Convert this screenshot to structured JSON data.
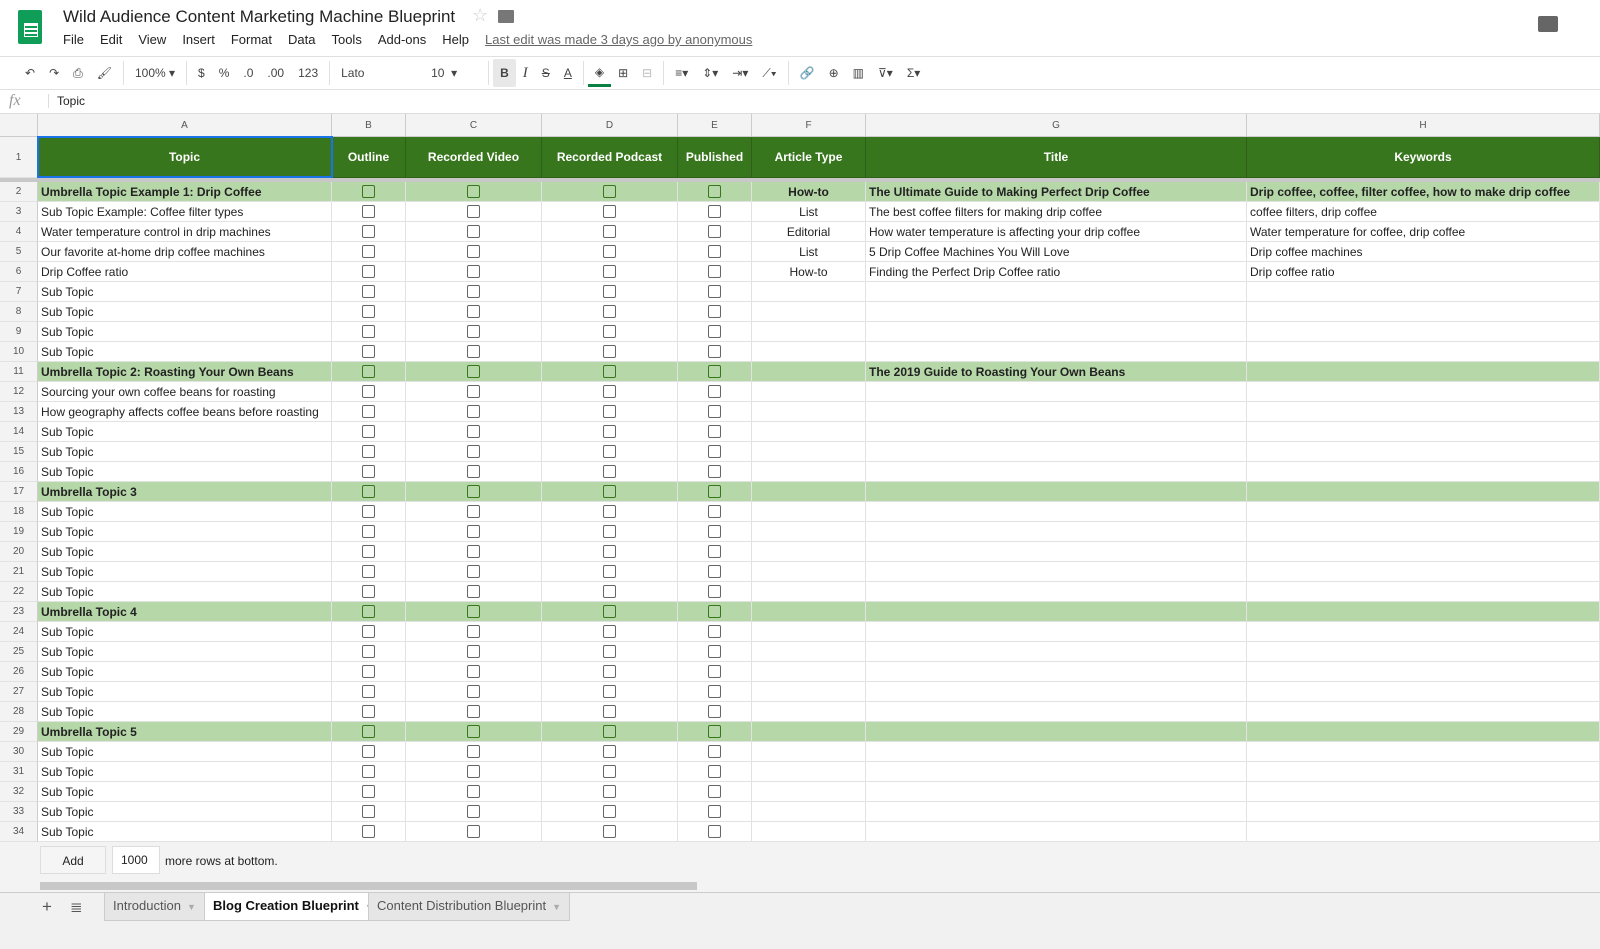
{
  "app": {
    "title": "Wild Audience Content Marketing Machine Blueprint",
    "last_edit": "Last edit was made 3 days ago by anonymous",
    "menu": [
      "File",
      "Edit",
      "View",
      "Insert",
      "Format",
      "Data",
      "Tools",
      "Add-ons",
      "Help"
    ]
  },
  "toolbar": {
    "zoom": "100%",
    "currency": "$",
    "percent": "%",
    "dec_less": ".0",
    "dec_more": ".00",
    "format": "123",
    "font": "Lato",
    "size": "10",
    "bold": "B",
    "italic": "I",
    "strike": "S",
    "textcolor": "A",
    "fill_color": "#0b8043"
  },
  "formula": {
    "fx": "fx",
    "value": "Topic"
  },
  "columns": [
    "A",
    "B",
    "C",
    "D",
    "E",
    "F",
    "G",
    "H"
  ],
  "headers": [
    "Topic",
    "Outline",
    "Recorded Video",
    "Recorded Podcast",
    "Published",
    "Article Type",
    "Title",
    "Keywords"
  ],
  "colors": {
    "header_bg": "#38761d",
    "umbrella_bg": "#b6d7a8"
  },
  "rows": [
    {
      "n": "2",
      "topic": "Umbrella Topic Example 1: Drip Coffee",
      "type": "How-to",
      "title": "The Ultimate Guide to Making Perfect Drip Coffee",
      "keywords": "Drip coffee, coffee, filter coffee, how to make drip coffee",
      "umbrella": true
    },
    {
      "n": "3",
      "topic": "Sub Topic Example: Coffee filter types",
      "type": "List",
      "title": "The best coffee filters for making drip coffee",
      "keywords": "coffee filters, drip coffee"
    },
    {
      "n": "4",
      "topic": "Water temperature control in drip machines",
      "type": "Editorial",
      "title": "How water temperature is affecting your drip coffee",
      "keywords": "Water temperature for coffee, drip coffee"
    },
    {
      "n": "5",
      "topic": "Our favorite at-home drip coffee machines",
      "type": "List",
      "title": "5 Drip Coffee Machines You Will Love",
      "keywords": "Drip coffee machines"
    },
    {
      "n": "6",
      "topic": "Drip Coffee ratio",
      "type": "How-to",
      "title": "Finding the Perfect Drip Coffee ratio",
      "keywords": "Drip coffee ratio"
    },
    {
      "n": "7",
      "topic": "Sub Topic"
    },
    {
      "n": "8",
      "topic": "Sub Topic"
    },
    {
      "n": "9",
      "topic": "Sub Topic"
    },
    {
      "n": "10",
      "topic": "Sub Topic"
    },
    {
      "n": "11",
      "topic": "Umbrella Topic 2: Roasting Your Own Beans",
      "title": "The 2019 Guide to Roasting Your Own Beans",
      "umbrella": true
    },
    {
      "n": "12",
      "topic": "Sourcing your own coffee beans for roasting"
    },
    {
      "n": "13",
      "topic": "How geography affects coffee beans before roasting"
    },
    {
      "n": "14",
      "topic": "Sub Topic"
    },
    {
      "n": "15",
      "topic": "Sub Topic"
    },
    {
      "n": "16",
      "topic": "Sub Topic"
    },
    {
      "n": "17",
      "topic": "Umbrella Topic 3",
      "umbrella": true
    },
    {
      "n": "18",
      "topic": "Sub Topic"
    },
    {
      "n": "19",
      "topic": "Sub Topic"
    },
    {
      "n": "20",
      "topic": "Sub Topic"
    },
    {
      "n": "21",
      "topic": "Sub Topic"
    },
    {
      "n": "22",
      "topic": "Sub Topic"
    },
    {
      "n": "23",
      "topic": "Umbrella Topic 4",
      "umbrella": true
    },
    {
      "n": "24",
      "topic": "Sub Topic"
    },
    {
      "n": "25",
      "topic": "Sub Topic"
    },
    {
      "n": "26",
      "topic": "Sub Topic"
    },
    {
      "n": "27",
      "topic": "Sub Topic"
    },
    {
      "n": "28",
      "topic": "Sub Topic"
    },
    {
      "n": "29",
      "topic": "Umbrella Topic 5",
      "umbrella": true
    },
    {
      "n": "30",
      "topic": "Sub Topic"
    },
    {
      "n": "31",
      "topic": "Sub Topic"
    },
    {
      "n": "32",
      "topic": "Sub Topic"
    },
    {
      "n": "33",
      "topic": "Sub Topic"
    },
    {
      "n": "34",
      "topic": "Sub Topic"
    }
  ],
  "bottom": {
    "add": "Add",
    "count": "1000",
    "more": "more rows at bottom."
  },
  "tabs": [
    {
      "label": "Introduction"
    },
    {
      "label": "Blog Creation Blueprint",
      "active": true
    },
    {
      "label": "Content Distribution Blueprint"
    }
  ]
}
